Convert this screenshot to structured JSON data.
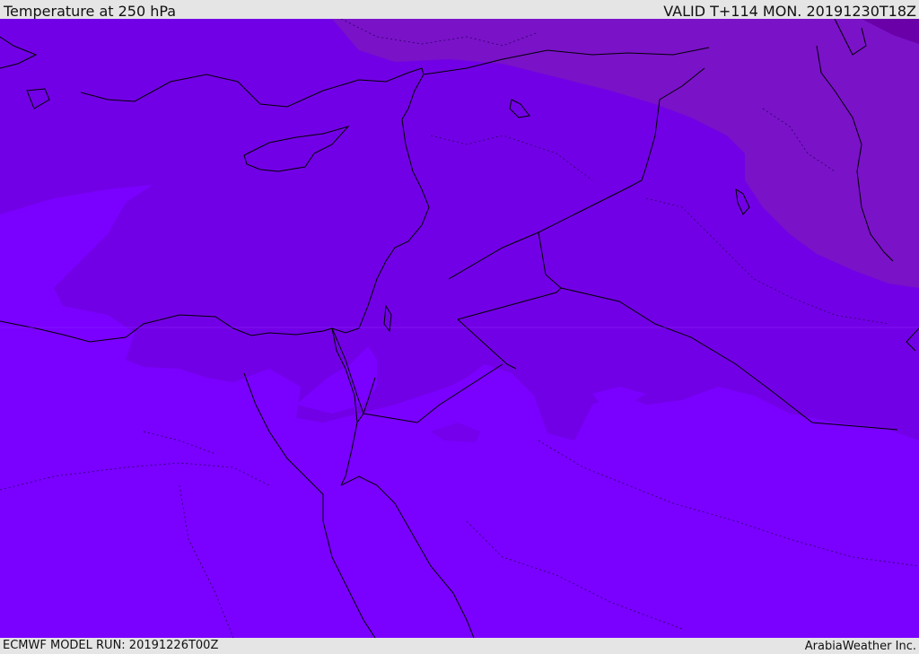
{
  "header": {
    "title": "Temperature at 250 hPa",
    "valid": "VALID T+114 MON. 20191230T18Z"
  },
  "footer": {
    "model_run": "ECMWF MODEL RUN: 20191226T00Z",
    "credit": "ArabiaWeather Inc."
  },
  "map": {
    "field": "temperature",
    "level": "250 hPa",
    "colors": {
      "band_warmest": "#7a00ff",
      "band_mid": "#7200e6",
      "band_cool": "#7a12c8",
      "band_coldest": "#6a00a8",
      "coastline": "#000000",
      "border": "#000000"
    }
  }
}
